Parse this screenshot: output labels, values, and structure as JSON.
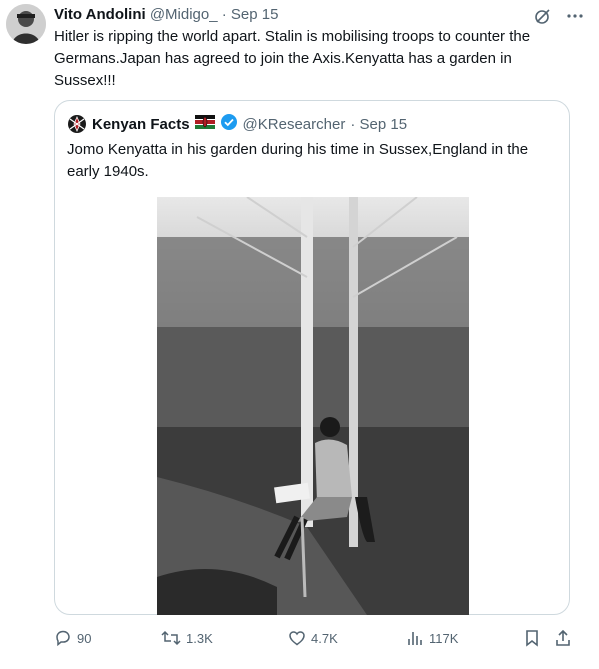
{
  "author": {
    "name": "Vito Andolini",
    "handle": "@Midigo_",
    "date": "· Sep 15"
  },
  "tweet_text": "Hitler is ripping the world apart. Stalin is mobilising troops to counter the Germans.Japan has agreed to join the Axis.Kenyatta has a garden in Sussex!!!",
  "quoted": {
    "name": "Kenyan Facts",
    "handle": "@KResearcher",
    "date": "· Sep 15",
    "text": "Jomo Kenyatta in his garden during his time in Sussex,England in the early 1940s."
  },
  "stats": {
    "replies": "90",
    "retweets": "1.3K",
    "likes": "4.7K",
    "views": "117K"
  },
  "colors": {
    "muted": "#536471",
    "verified": "#1d9bf0",
    "border": "#cfd9de"
  },
  "icons": [
    "grok-icon",
    "more-icon",
    "flag-kenya-icon",
    "verified-badge-icon",
    "reply-icon",
    "retweet-icon",
    "like-icon",
    "views-icon",
    "bookmark-icon",
    "share-icon"
  ]
}
